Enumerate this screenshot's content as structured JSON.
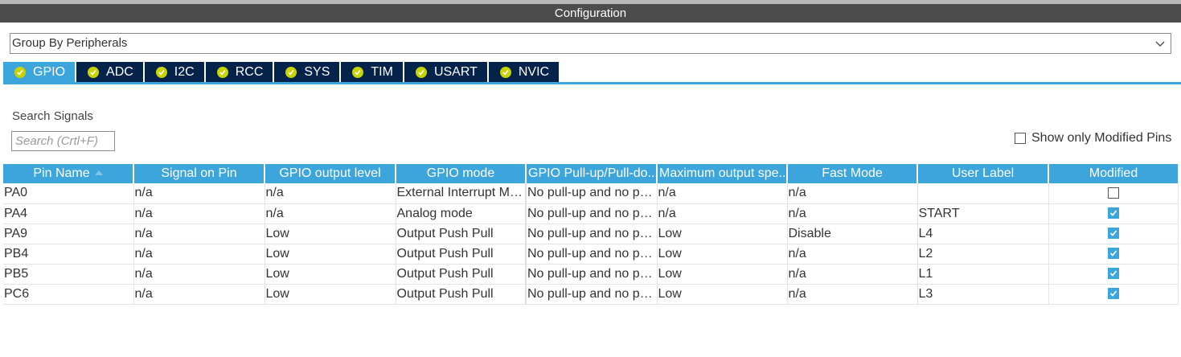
{
  "window": {
    "title": "Configuration"
  },
  "group_by": {
    "value": "Group By Peripherals"
  },
  "tabs": [
    {
      "label": "GPIO",
      "active": true
    },
    {
      "label": "ADC"
    },
    {
      "label": "I2C"
    },
    {
      "label": "RCC"
    },
    {
      "label": "SYS"
    },
    {
      "label": "TIM"
    },
    {
      "label": "USART"
    },
    {
      "label": "NVIC"
    }
  ],
  "search": {
    "label": "Search Signals",
    "placeholder": "Search (Crtl+F)"
  },
  "filter": {
    "show_modified_label": "Show only Modified Pins",
    "checked": false
  },
  "table": {
    "columns": [
      "Pin Name",
      "Signal on Pin",
      "GPIO output level",
      "GPIO mode",
      "GPIO Pull-up/Pull-do...",
      "Maximum output spe...",
      "Fast Mode",
      "User Label",
      "Modified"
    ],
    "rows": [
      {
        "pin": "PA0",
        "signal": "n/a",
        "level": "n/a",
        "mode": "External Interrupt Mo...",
        "pull": "No pull-up and no pu...",
        "speed": "n/a",
        "fast": "n/a",
        "label": "",
        "modified": false
      },
      {
        "pin": "PA4",
        "signal": "n/a",
        "level": "n/a",
        "mode": "Analog mode",
        "pull": "No pull-up and no pu...",
        "speed": "n/a",
        "fast": "n/a",
        "label": "START",
        "modified": true
      },
      {
        "pin": "PA9",
        "signal": "n/a",
        "level": "Low",
        "mode": "Output Push Pull",
        "pull": "No pull-up and no pu...",
        "speed": "Low",
        "fast": "Disable",
        "label": "L4",
        "modified": true
      },
      {
        "pin": "PB4",
        "signal": "n/a",
        "level": "Low",
        "mode": "Output Push Pull",
        "pull": "No pull-up and no pu...",
        "speed": "Low",
        "fast": "n/a",
        "label": "L2",
        "modified": true
      },
      {
        "pin": "PB5",
        "signal": "n/a",
        "level": "Low",
        "mode": "Output Push Pull",
        "pull": "No pull-up and no pu...",
        "speed": "Low",
        "fast": "n/a",
        "label": "L1",
        "modified": true
      },
      {
        "pin": "PC6",
        "signal": "n/a",
        "level": "Low",
        "mode": "Output Push Pull",
        "pull": "No pull-up and no pu...",
        "speed": "Low",
        "fast": "n/a",
        "label": "L3",
        "modified": true
      }
    ]
  },
  "colors": {
    "accent": "#3ca6dc",
    "tab_bg": "#03234b",
    "title_bar": "#4c4c4c",
    "check_badge": "#c8d400"
  }
}
